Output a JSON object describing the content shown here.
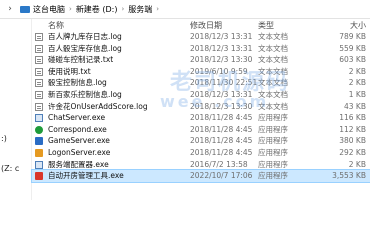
{
  "breadcrumb": {
    "nav_glyph": "›",
    "items": [
      "这台电脑",
      "新建卷 (D:)",
      "服务端"
    ],
    "sep": "›"
  },
  "left_nav": {
    "items": [
      ":)",
      "(Z: c"
    ]
  },
  "columns": {
    "name": "名称",
    "date": "修改日期",
    "type": "类型",
    "size": "大小"
  },
  "files": [
    {
      "name": "百人牌九库存日志.log",
      "date": "2018/12/3 13:31",
      "type": "文本文档",
      "size": "789 KB",
      "icon": "log-file-icon"
    },
    {
      "name": "百人骰宝库存信息.log",
      "date": "2018/12/3 13:31",
      "type": "文本文档",
      "size": "559 KB",
      "icon": "log-file-icon"
    },
    {
      "name": "碰碰车控制记录.txt",
      "date": "2018/12/3 13:30",
      "type": "文本文档",
      "size": "603 KB",
      "icon": "text-file-icon"
    },
    {
      "name": "使用说明.txt",
      "date": "2019/6/10 9:59",
      "type": "文本文档",
      "size": "2 KB",
      "icon": "text-file-icon"
    },
    {
      "name": "骰宝控制信息.log",
      "date": "2018/11/30 22:51",
      "type": "文本文档",
      "size": "2 KB",
      "icon": "log-file-icon"
    },
    {
      "name": "新百家乐控制信息.log",
      "date": "2018/12/3 13:31",
      "type": "文本文档",
      "size": "1 KB",
      "icon": "log-file-icon"
    },
    {
      "name": "许金花OnUserAddScore.log",
      "date": "2018/12/3 13:30",
      "type": "文本文档",
      "size": "43 KB",
      "icon": "log-file-icon"
    },
    {
      "name": "ChatServer.exe",
      "date": "2018/11/28 4:45",
      "type": "应用程序",
      "size": "116 KB",
      "icon": "chat-server-icon"
    },
    {
      "name": "Correspond.exe",
      "date": "2018/11/28 4:45",
      "type": "应用程序",
      "size": "112 KB",
      "icon": "correspond-icon"
    },
    {
      "name": "GameServer.exe",
      "date": "2018/11/28 4:45",
      "type": "应用程序",
      "size": "380 KB",
      "icon": "game-server-icon"
    },
    {
      "name": "LogonServer.exe",
      "date": "2018/11/28 4:45",
      "type": "应用程序",
      "size": "292 KB",
      "icon": "logon-server-icon"
    },
    {
      "name": "服务端配置器.exe",
      "date": "2016/7/2 13:58",
      "type": "应用程序",
      "size": "2 KB",
      "icon": "config-tool-icon"
    },
    {
      "name": "自动开房管理工具.exe",
      "date": "2022/10/7 17:06",
      "type": "应用程序",
      "size": "3,553 KB",
      "icon": "room-manager-icon",
      "selected": true
    }
  ],
  "watermark": {
    "line1": "老司机源码",
    "line2": "wee   .com"
  },
  "colors": {
    "selection": "#cce8ff",
    "accent": "#2b79c8"
  }
}
